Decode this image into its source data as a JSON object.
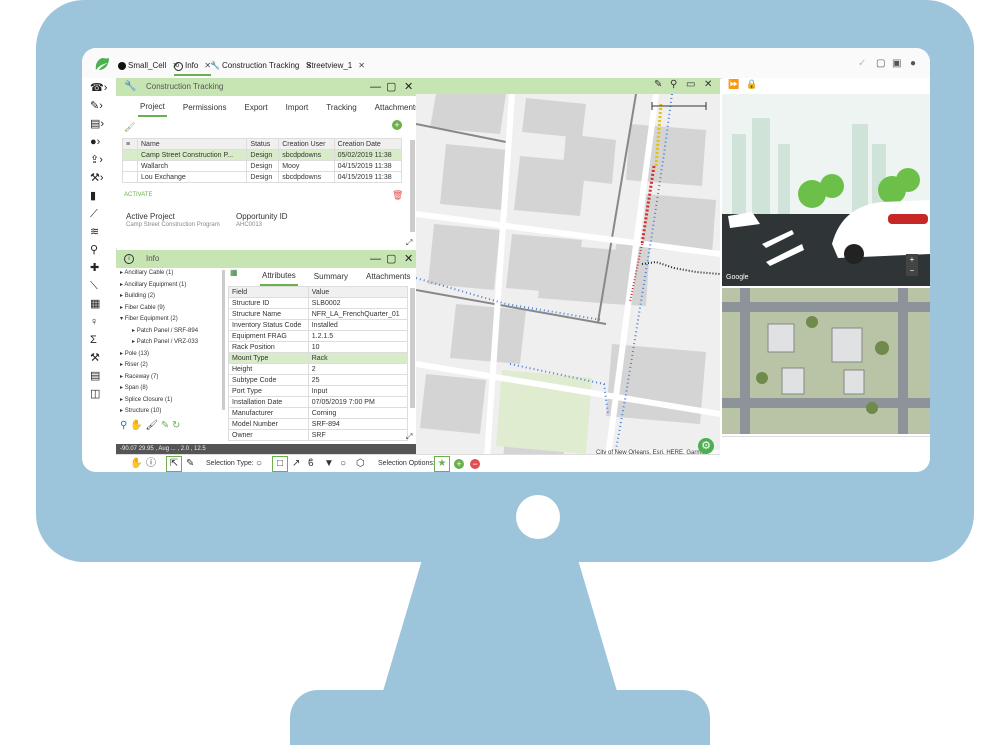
{
  "tabs": [
    {
      "label": "Small_Cell"
    },
    {
      "label": "Info"
    },
    {
      "label": "Construction Tracking"
    },
    {
      "label": "Streetview_1"
    }
  ],
  "construction_panel": {
    "title": "Construction Tracking",
    "subtabs": [
      "Project",
      "Permissions",
      "Export",
      "Import",
      "Tracking",
      "Attachments"
    ],
    "table_headers": [
      "Name",
      "Status",
      "Creation User",
      "Creation Date"
    ],
    "rows": [
      [
        "Camp Street Construction P...",
        "Design",
        "sbcdpdowns",
        "05/02/2019 11:38"
      ],
      [
        "Wallarch",
        "Design",
        "Mooy",
        "04/15/2019 11:38"
      ],
      [
        "Lou Exchange",
        "Design",
        "sbcdpdowns",
        "04/15/2019 11:38"
      ]
    ],
    "activate_label": "ACTIVATE",
    "active_project_label": "Active Project",
    "active_project_value": "Camp Street Construction Program",
    "opportunity_label": "Opportunity ID",
    "opportunity_value": "AHC0013"
  },
  "info_panel": {
    "title": "Info",
    "tree": [
      "Ancillary Cable (1)",
      "Ancillary Equipment (1)",
      "Building (2)",
      "Fiber Cable (9)",
      "Fiber Equipment (2)",
      "Patch Panel / SRF-894",
      "Patch Panel / VRZ-033",
      "Pole (13)",
      "Riser (2)",
      "Raceway (7)",
      "Span (8)",
      "Splice Closure (1)",
      "Structure (10)"
    ],
    "subtabs": [
      "Attributes",
      "Summary",
      "Attachments"
    ],
    "attr_headers": [
      "Field",
      "Value"
    ],
    "attributes": [
      [
        "Structure ID",
        "SLB0002"
      ],
      [
        "Structure Name",
        "NFR_LA_FrenchQuarter_01"
      ],
      [
        "Inventory Status Code",
        "Installed"
      ],
      [
        "Equipment FRAG",
        "1.2.1.5"
      ],
      [
        "Rack Position",
        "10"
      ],
      [
        "Mount Type",
        "Rack"
      ],
      [
        "Height",
        "2"
      ],
      [
        "Subtype Code",
        "25"
      ],
      [
        "Port Type",
        "Input"
      ],
      [
        "Installation Date",
        "07/05/2019 7:00 PM"
      ],
      [
        "Manufacturer",
        "Corning"
      ],
      [
        "Model Number",
        "SRF-894"
      ],
      [
        "Owner",
        "SRF"
      ]
    ]
  },
  "map": {
    "attribution": "City of New Orleans, Esri, HERE, Garmin, INCREMENT P, NGA, EPA, USDA"
  },
  "streetview": {
    "brand": "Google"
  },
  "statusbar": {
    "coords": "-90.07 29.95 , Aug ... , 2.0 , 12.5",
    "selection_type_label": "Selection Type:",
    "selection_options_label": "Selection Options:"
  },
  "colors": {
    "accent": "#6ab04c",
    "panel_header": "#c7e4b3",
    "monitor": "#9cc5dc"
  }
}
